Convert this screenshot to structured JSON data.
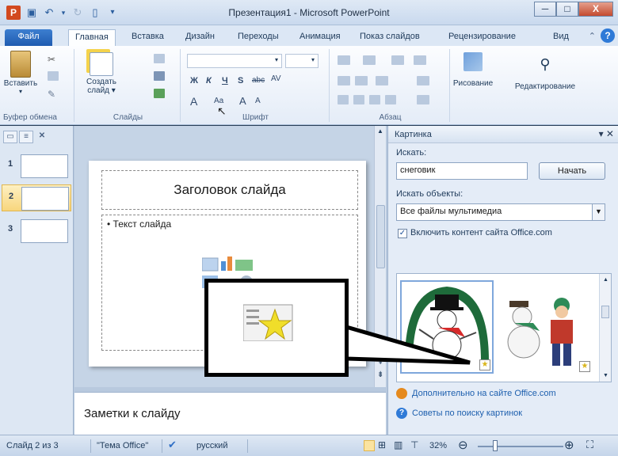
{
  "window": {
    "title": "Презентация1  -  Microsoft PowerPoint",
    "app_icon_letter": "P",
    "controls": {
      "minimize": "─",
      "maximize": "□",
      "close": "X"
    }
  },
  "tabs": [
    {
      "label": "Файл"
    },
    {
      "label": "Главная"
    },
    {
      "label": "Вставка"
    },
    {
      "label": "Дизайн"
    },
    {
      "label": "Переходы"
    },
    {
      "label": "Анимация"
    },
    {
      "label": "Показ слайдов"
    },
    {
      "label": "Рецензирование"
    },
    {
      "label": "Вид"
    }
  ],
  "ribbon": {
    "paste_label": "Вставить",
    "new_slide_label_1": "Создать",
    "new_slide_label_2": "слайд ▾",
    "drawing_label": "Рисование",
    "editing_label": "Редактирование",
    "groups": {
      "clipboard": "Буфер обмена",
      "slides": "Слайды",
      "font": "Шрифт",
      "paragraph": "Абзац"
    },
    "font_buttons": {
      "bold": "Ж",
      "italic": "К",
      "underline": "Ч",
      "shadow": "S",
      "strike": "abc",
      "spacing": "AV"
    }
  },
  "slides_pane": {
    "slides": [
      {
        "number": "1"
      },
      {
        "number": "2"
      },
      {
        "number": "3"
      }
    ]
  },
  "slide": {
    "title_placeholder": "Заголовок слайда",
    "body_placeholder": "• Текст слайда"
  },
  "notes": {
    "placeholder": "Заметки к слайду"
  },
  "clip_art": {
    "pane_title": "Картинка",
    "search_label": "Искать:",
    "search_value": "снеговик",
    "search_button": "Начать",
    "objects_label": "Искать объекты:",
    "objects_value": "Все файлы мультимедиа",
    "include_office_label": "Включить контент сайта Office.com",
    "include_office_checked": true,
    "more_link": "Дополнительно на сайте Office.com",
    "tips_link": "Советы по поиску картинок"
  },
  "statusbar": {
    "slide_info": "Слайд 2 из 3",
    "theme": "\"Тема Office\"",
    "language": "русский",
    "zoom": "32%"
  }
}
